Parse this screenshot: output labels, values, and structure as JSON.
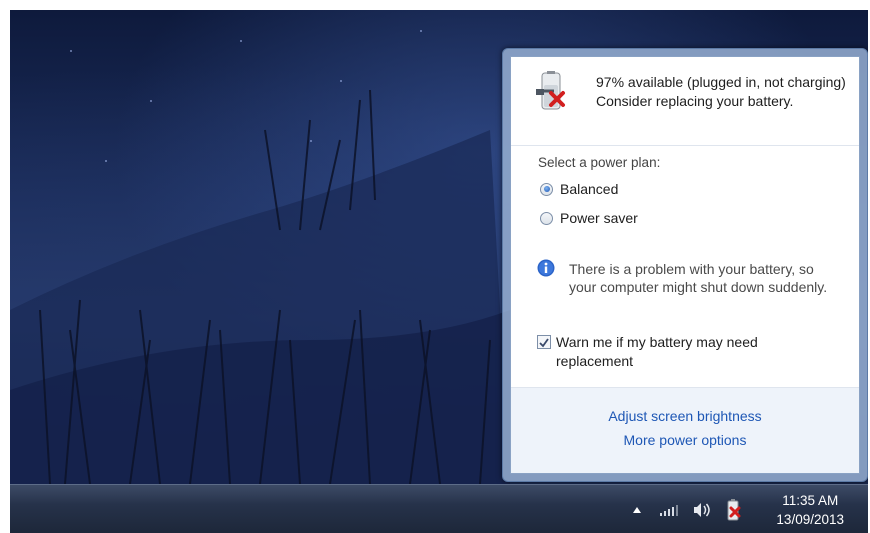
{
  "power_flyout": {
    "status": {
      "line1": "97% available (plugged in, not charging)",
      "line2": "Consider replacing your battery."
    },
    "plan_label": "Select a power plan:",
    "plans": [
      {
        "label": "Balanced",
        "selected": true
      },
      {
        "label": "Power saver",
        "selected": false
      }
    ],
    "warning": "There is a problem with your battery, so your computer might shut down suddenly.",
    "warn_checkbox": {
      "label": "Warn me if my battery may need replacement",
      "checked": true
    },
    "links": {
      "brightness": "Adjust screen brightness",
      "more_options": "More power options"
    }
  },
  "taskbar": {
    "time": "11:35 AM",
    "date": "13/09/2013"
  },
  "icons": {
    "battery_status": "battery-warning-icon",
    "info": "info-icon",
    "tray": [
      "show-hidden-icons-arrow",
      "network-signal-icon",
      "volume-icon",
      "battery-warning-icon"
    ]
  },
  "colors": {
    "link": "#1e57b5",
    "taskbar": "#26324a",
    "warning_red": "#d21f1f"
  }
}
